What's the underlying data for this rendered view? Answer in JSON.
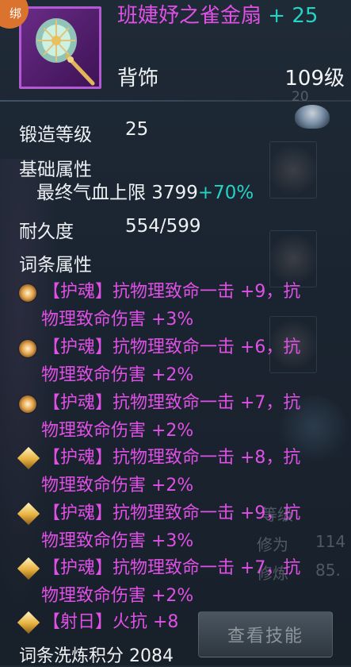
{
  "item": {
    "bind_badge": "绑",
    "name": "班婕妤之雀金扇",
    "enhance": "+ 25",
    "type": "背饰",
    "level": "109级"
  },
  "stats": {
    "forge_label": "锻造等级",
    "forge_value": "25",
    "base_label": "基础属性",
    "base_attr": "最终气血上限 3799",
    "base_bonus": "+70%",
    "durability_label": "耐久度",
    "durability_value": "554/599",
    "affix_label": "词条属性"
  },
  "affixes": [
    {
      "icon": "soul-icon",
      "line1": "【护魂】抗物理致命一击 +9，抗",
      "line2": "物理致命伤害 +3%"
    },
    {
      "icon": "soul-icon",
      "line1": "【护魂】抗物理致命一击 +6，抗",
      "line2": "物理致命伤害 +2%"
    },
    {
      "icon": "soul-icon",
      "line1": "【护魂】抗物理致命一击 +7，抗",
      "line2": "物理致命伤害 +2%"
    },
    {
      "icon": "diamond-icon",
      "line1": "【护魂】抗物理致命一击 +8，抗",
      "line2": "物理致命伤害 +2%"
    },
    {
      "icon": "diamond-icon",
      "line1": "【护魂】抗物理致命一击 +9，抗",
      "line2": "物理致命伤害 +3%"
    },
    {
      "icon": "diamond-icon",
      "line1": "【护魂】抗物理致命一击 +7，抗",
      "line2": "物理致命伤害 +2%"
    },
    {
      "icon": "diamond-icon",
      "line1": "【射日】火抗 +8",
      "line2": ""
    }
  ],
  "footer": {
    "refine_points": "词条洗炼积分 2084"
  },
  "background": {
    "view_skills_button": "查看技能",
    "cultivation_label": "修为",
    "cultivation_value": "114",
    "refine_label": "修炼",
    "refine_value": "85.",
    "level_label": "等级",
    "slot_badge": "20"
  },
  "colors": {
    "affix_purple": "#e050e6",
    "bonus_cyan": "#25d3c5",
    "bind_orange": "#d9732e"
  }
}
